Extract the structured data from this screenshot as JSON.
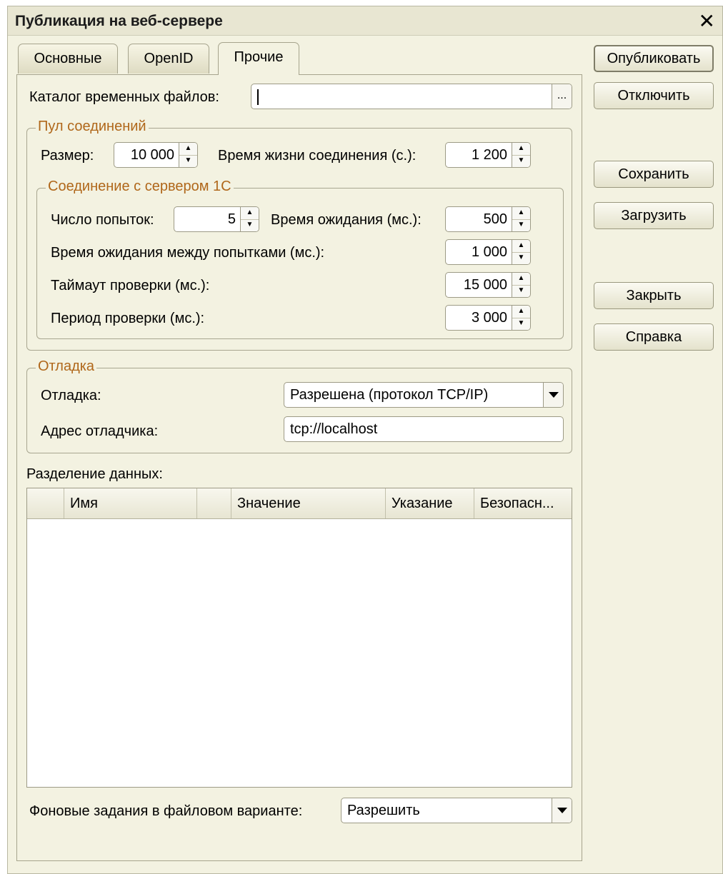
{
  "window": {
    "title": "Публикация на веб-сервере"
  },
  "tabs": [
    {
      "label": "Основные"
    },
    {
      "label": "OpenID"
    },
    {
      "label": "Прочие"
    }
  ],
  "temp_catalog": {
    "label": "Каталог временных файлов:",
    "value": "",
    "browse": "..."
  },
  "pool": {
    "legend": "Пул соединений",
    "size_label": "Размер:",
    "size_value": "10 000",
    "lifetime_label": "Время жизни соединения (с.):",
    "lifetime_value": "1 200",
    "server": {
      "legend": "Соединение с сервером 1С",
      "attempts_label": "Число попыток:",
      "attempts_value": "5",
      "wait_label": "Время ожидания (мс.):",
      "wait_value": "500",
      "between_label": "Время ожидания между попытками (мс.):",
      "between_value": "1 000",
      "check_timeout_label": "Таймаут проверки (мс.):",
      "check_timeout_value": "15 000",
      "check_period_label": "Период проверки (мс.):",
      "check_period_value": "3 000"
    }
  },
  "debug": {
    "legend": "Отладка",
    "mode_label": "Отладка:",
    "mode_value": "Разрешена (протокол TCP/IP)",
    "address_label": "Адрес отладчика:",
    "address_value": "tcp://localhost"
  },
  "data_separation": {
    "label": "Разделение данных:",
    "columns": [
      "Имя",
      "Значение",
      "Указание",
      "Безопасн..."
    ],
    "rows": []
  },
  "background_jobs": {
    "label": "Фоновые задания в файловом варианте:",
    "value": "Разрешить"
  },
  "buttons": {
    "publish": "Опубликовать",
    "disable": "Отключить",
    "save": "Сохранить",
    "load": "Загрузить",
    "close": "Закрыть",
    "help": "Справка"
  }
}
